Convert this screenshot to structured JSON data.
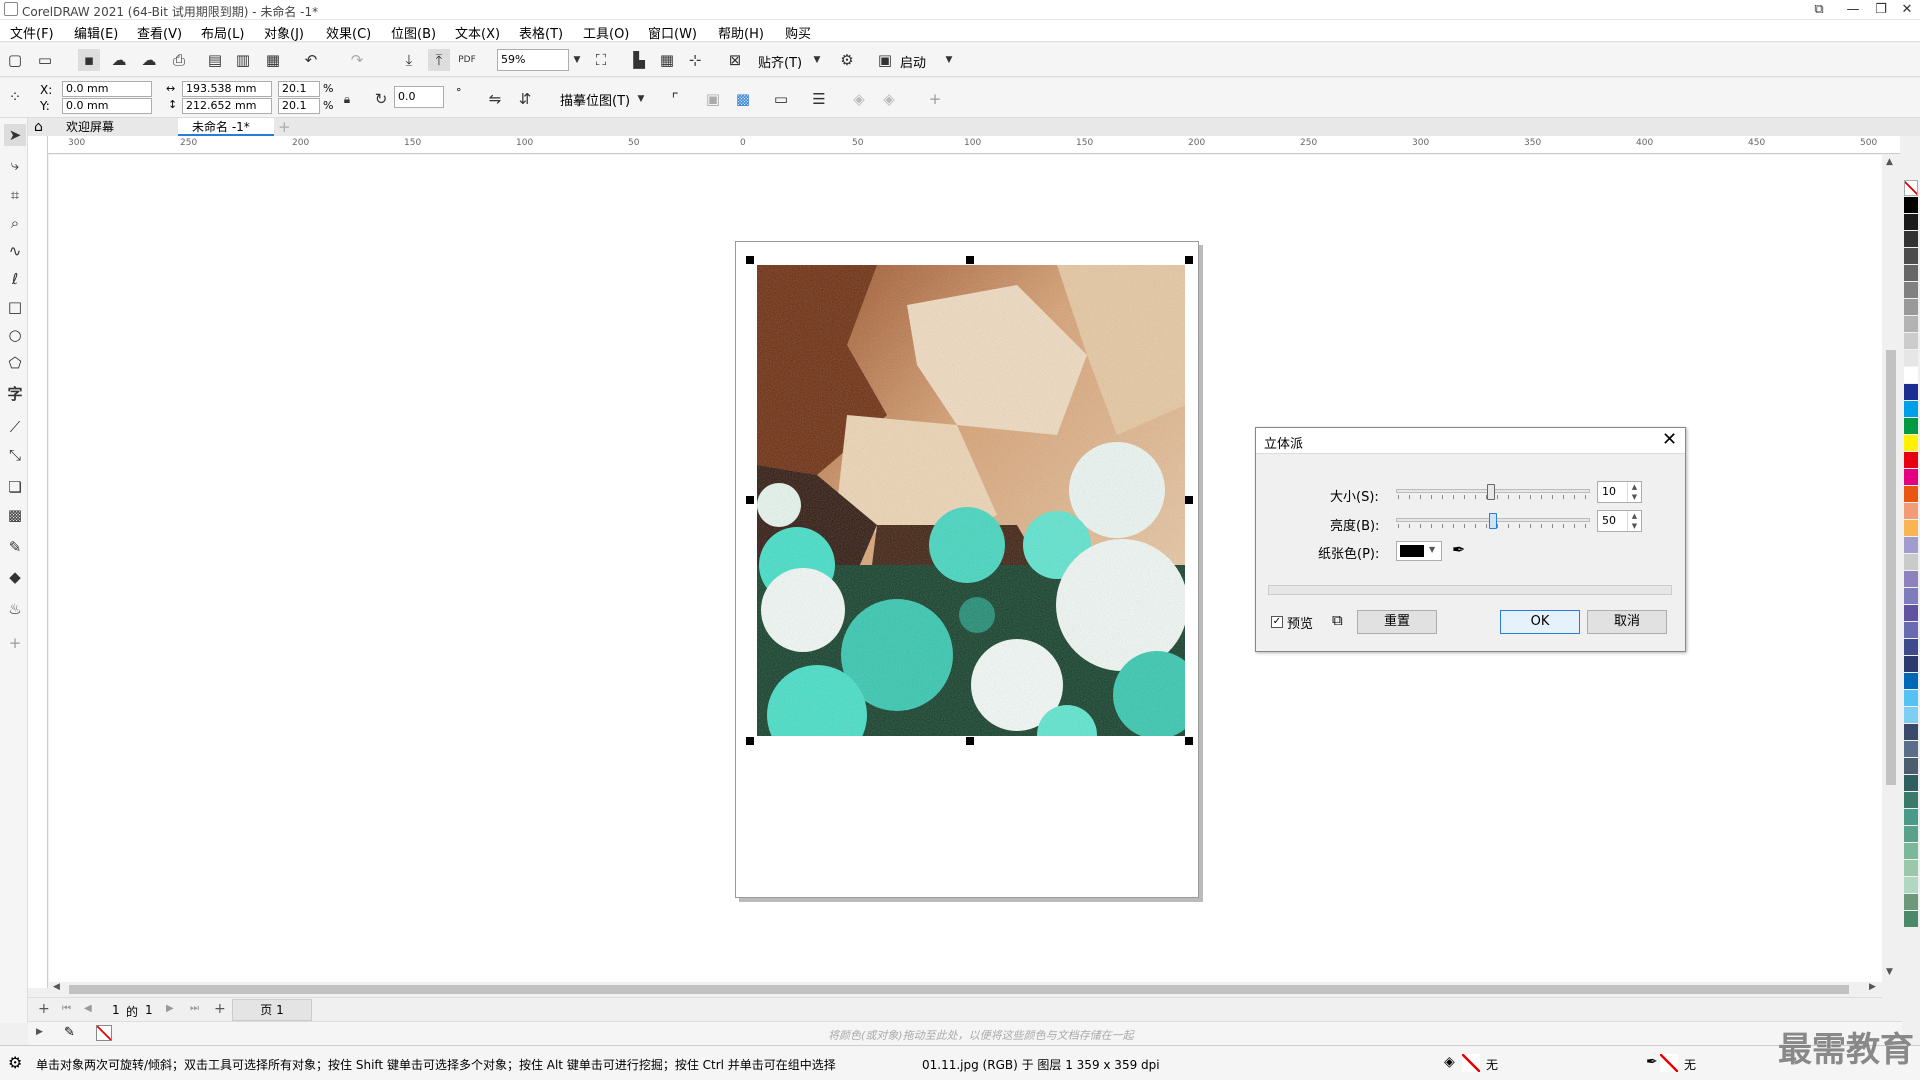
{
  "window": {
    "title": "CorelDRAW 2021 (64-Bit 试用期限到期) - 未命名 -1*"
  },
  "menu": [
    "文件(F)",
    "编辑(E)",
    "查看(V)",
    "布局(L)",
    "对象(J)",
    "效果(C)",
    "位图(B)",
    "文本(X)",
    "表格(T)",
    "工具(O)",
    "窗口(W)",
    "帮助(H)",
    "购买"
  ],
  "toolbar1": {
    "zoom": "59%",
    "snap_label": "贴齐(T)",
    "launch_label": "启动"
  },
  "properties": {
    "x_label": "X:",
    "x_value": "0.0 mm",
    "y_label": "Y:",
    "y_value": "0.0 mm",
    "width_value": "193.538 mm",
    "height_value": "212.652 mm",
    "scale_x": "20.1",
    "scale_y": "20.1",
    "percent": "%",
    "rotation": "0.0",
    "degree": "°",
    "trace_label": "描摹位图(T)"
  },
  "tabs": [
    {
      "label": "欢迎屏幕"
    },
    {
      "label": "未命名 -1*"
    }
  ],
  "ruler_h": [
    "300",
    "250",
    "200",
    "150",
    "100",
    "50",
    "0",
    "50",
    "100",
    "150",
    "200",
    "250",
    "300",
    "350",
    "400",
    "450",
    "500"
  ],
  "page_nav": {
    "current": "1",
    "of_label": "的",
    "total": "1",
    "page_tab": "页 1"
  },
  "color_hint": "将颜色(或对象)拖动至此处，以便将这些颜色与文档存储在一起",
  "status": {
    "hint": "单击对象两次可旋转/倾斜；双击工具可选择所有对象；按住 Shift 键单击可选择多个对象；按住 Alt 键单击可进行挖掘；按住 Ctrl 并单击可在组中选择",
    "object_info": "01.11.jpg (RGB) 于 图层 1 359 x 359 dpi",
    "fill_none": "无",
    "outline_none": "无"
  },
  "watermark": "最需教育",
  "dialog": {
    "title": "立体派",
    "size_label": "大小(S):",
    "size_value": "10",
    "size_level": 0.49,
    "brightness_label": "亮度(B):",
    "brightness_value": "50",
    "brightness_level": 0.5,
    "paper_color_label": "纸张色(P):",
    "preview_label": "预览",
    "reset_label": "重置",
    "ok_label": "OK",
    "cancel_label": "取消"
  },
  "palette_colors": [
    "#ffffff",
    "#000000",
    "#1a1a1a",
    "#333333",
    "#4d4d4d",
    "#666666",
    "#808080",
    "#999999",
    "#b3b3b3",
    "#cccccc",
    "#e6e6e6",
    "#ffffff",
    "#1b2d8f",
    "#00a0e9",
    "#009944",
    "#fff100",
    "#e60012",
    "#e4007f",
    "#ea5514",
    "#f29b76",
    "#f8b551",
    "#a29bce",
    "#c9caca",
    "#8f82bc",
    "#7d7dbc",
    "#5f52a0",
    "#6a6ab0",
    "#3e4a8c",
    "#2b3a6b",
    "#0068b7",
    "#54c3f1",
    "#7ecef4",
    "#3b4a6b",
    "#5a6e8a",
    "#4c5d6e",
    "#2f5f5f",
    "#3a7a6a",
    "#4a9a8a",
    "#5aa08a",
    "#7ab89a",
    "#9ac8aa",
    "#b0d8c0",
    "#6a9a7a",
    "#4a8a6a"
  ]
}
